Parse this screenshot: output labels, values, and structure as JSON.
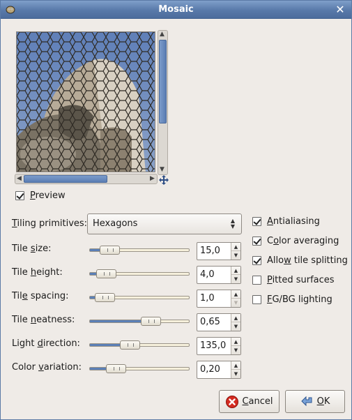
{
  "window": {
    "title": "Mosaic"
  },
  "preview": {
    "checkbox_label_u": "P",
    "checkbox_label_rest": "review",
    "checked": true
  },
  "tiling": {
    "label_u": "T",
    "label_rest": "iling primitives:",
    "value": "Hexagons"
  },
  "params": [
    {
      "pre": "Tile ",
      "u": "s",
      "post": "ize:",
      "value": "15,0",
      "fraction": 0.12
    },
    {
      "pre": "Tile ",
      "u": "h",
      "post": "eight:",
      "value": "4,0",
      "fraction": 0.08
    },
    {
      "pre": "Til",
      "u": "e",
      "post": " spacing:",
      "value": "1,0",
      "fraction": 0.06,
      "down_disabled": true
    },
    {
      "pre": "Tile ",
      "u": "n",
      "post": "eatness:",
      "value": "0,65",
      "fraction": 0.65
    },
    {
      "pre": "Light ",
      "u": "d",
      "post": "irection:",
      "value": "135,0",
      "fraction": 0.38
    },
    {
      "pre": "Color ",
      "u": "v",
      "post": "ariation:",
      "value": "0,20",
      "fraction": 0.2
    }
  ],
  "options": [
    {
      "pre": "",
      "u": "A",
      "post": "ntialiasing",
      "checked": true
    },
    {
      "pre": "C",
      "u": "o",
      "post": "lor averaging",
      "checked": true
    },
    {
      "pre": "Allo",
      "u": "w",
      "post": " tile splitting",
      "checked": true
    },
    {
      "pre": "",
      "u": "P",
      "post": "itted surfaces",
      "checked": false
    },
    {
      "pre": "",
      "u": "F",
      "post": "G/BG lighting",
      "checked": false
    }
  ],
  "buttons": {
    "cancel": {
      "u": "C",
      "rest": "ancel",
      "icon": "cancel-icon"
    },
    "ok": {
      "u": "O",
      "rest": "K",
      "icon": "ok-arrow-icon"
    }
  },
  "colors": {
    "accent": "#5b80b7",
    "titlebar": "#5879a9"
  }
}
